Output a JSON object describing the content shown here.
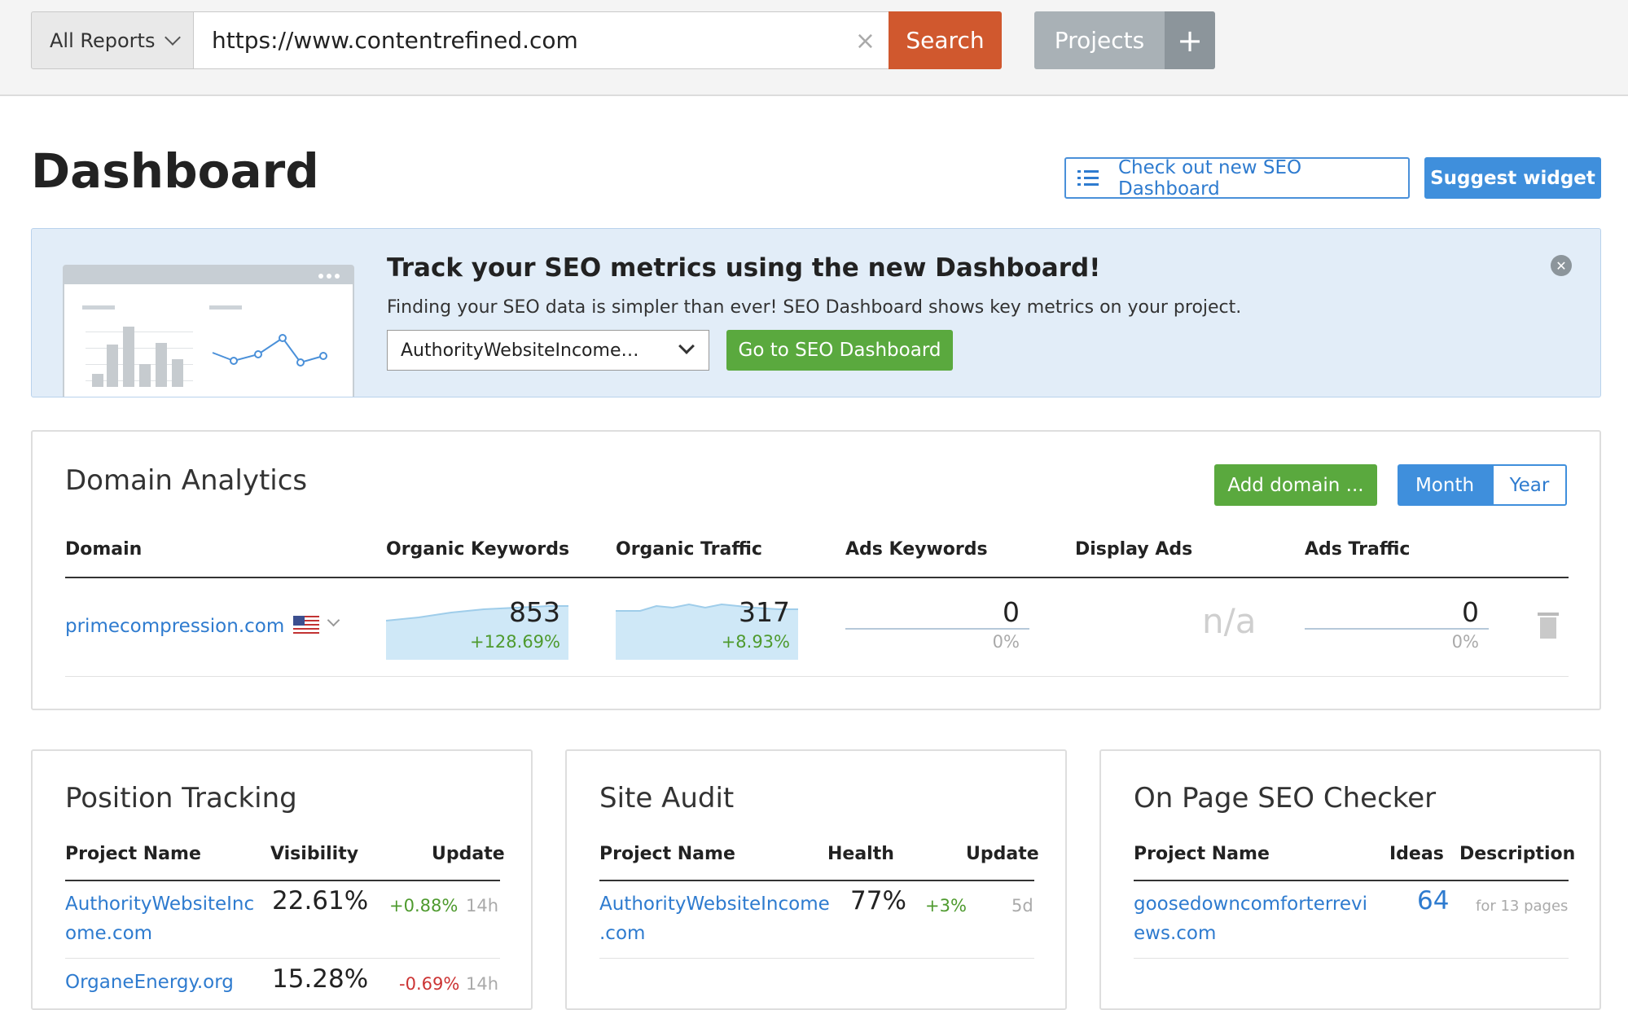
{
  "topbar": {
    "report_selector": "All Reports",
    "url": "https://www.contentrefined.com",
    "clear_symbol": "×",
    "search_label": "Search",
    "projects_label": "Projects",
    "plus_symbol": "+"
  },
  "header": {
    "title": "Dashboard",
    "new_dashboard_label": "Check out new SEO Dashboard",
    "suggest_label": "Suggest widget"
  },
  "banner": {
    "title": "Track your SEO metrics using the new Dashboard!",
    "subtitle": "Finding your SEO data is simpler than ever! SEO Dashboard shows key metrics on your project.",
    "project_select": "AuthorityWebsiteIncome…",
    "go_label": "Go to SEO Dashboard",
    "close_symbol": "✕"
  },
  "domain_analytics": {
    "title": "Domain Analytics",
    "add_domain_label": "Add domain ...",
    "period_month": "Month",
    "period_year": "Year",
    "columns": [
      "Domain",
      "Organic Keywords",
      "Organic Traffic",
      "Ads Keywords",
      "Display Ads",
      "Ads Traffic"
    ],
    "row": {
      "domain": "primecompression.com",
      "organic_keywords": "853",
      "organic_keywords_change": "+128.69%",
      "organic_traffic": "317",
      "organic_traffic_change": "+8.93%",
      "ads_keywords": "0",
      "ads_keywords_change": "0%",
      "display_ads": "n/a",
      "ads_traffic": "0",
      "ads_traffic_change": "0%"
    },
    "colors": {
      "spark_fill": "#cfe8f7",
      "spark_line": "#9fcdea"
    }
  },
  "position_tracking": {
    "title": "Position Tracking",
    "col_project": "Project Name",
    "col_visibility": "Visibility",
    "col_update": "Update",
    "rows": [
      {
        "name_l1": "AuthorityWebsiteInc",
        "name_l2": "ome.com",
        "visibility": "22.61%",
        "change": "+0.88%",
        "update": "14h"
      },
      {
        "name_l1": "OrganeEnergy.org",
        "visibility": "15.28%",
        "change": "-0.69%",
        "update": "14h"
      }
    ]
  },
  "site_audit": {
    "title": "Site Audit",
    "col_project": "Project Name",
    "col_health": "Health",
    "col_update": "Update",
    "rows": [
      {
        "name_l1": "AuthorityWebsiteIncome",
        "name_l2": ".com",
        "health": "77%",
        "change": "+3%",
        "update": "5d"
      }
    ]
  },
  "on_page_seo": {
    "title": "On Page SEO Checker",
    "col_project": "Project Name",
    "col_ideas": "Ideas",
    "col_description": "Description",
    "rows": [
      {
        "name_l1": "goosedowncomforterrevi",
        "name_l2": "ews.com",
        "ideas": "64",
        "description": "for 13 pages"
      }
    ]
  }
}
